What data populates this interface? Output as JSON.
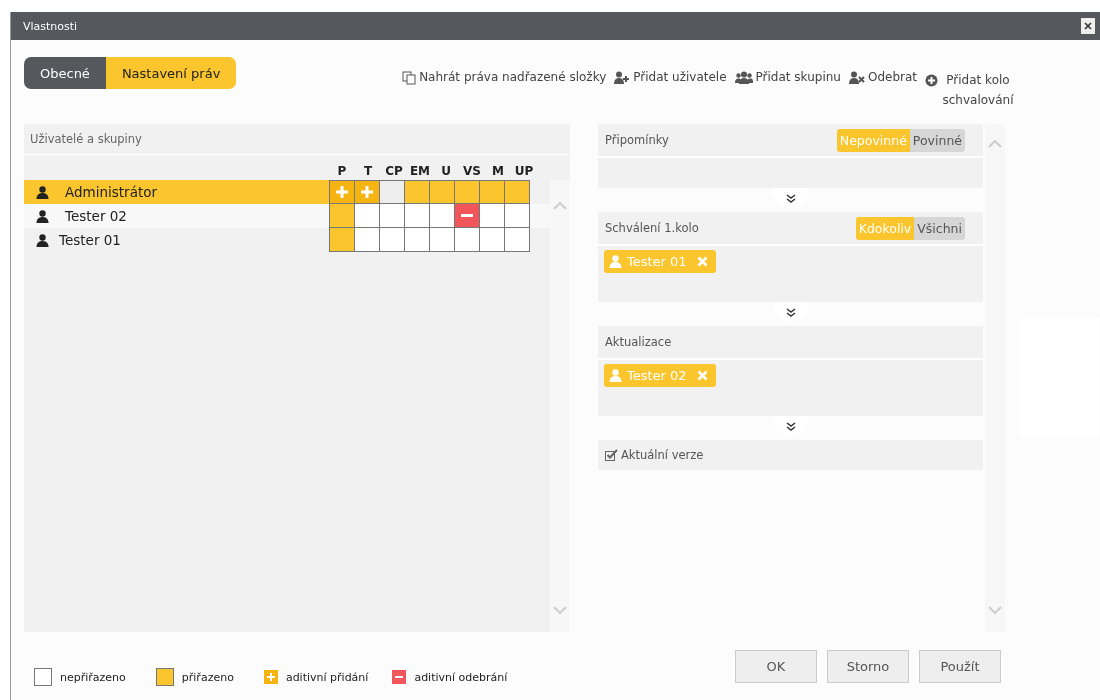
{
  "window": {
    "title": "Vlastnosti"
  },
  "tabs": [
    {
      "label": "Obecné",
      "selected": false
    },
    {
      "label": "Nastavení práv",
      "selected": true
    }
  ],
  "toolbar": [
    {
      "kind": "copy",
      "label": "Nahrát práva nadřazené složky"
    },
    {
      "kind": "add-user",
      "label": "Přidat uživatele"
    },
    {
      "kind": "add-group",
      "label": "Přidat skupinu"
    },
    {
      "kind": "remove-user",
      "label": "Odebrat"
    },
    {
      "kind": "add-round",
      "label": "Přidat kolo schvalování"
    }
  ],
  "permissions": {
    "title": "Uživatelé a skupiny",
    "columns": [
      "P",
      "T",
      "CP",
      "EM",
      "U",
      "VS",
      "M",
      "UP"
    ],
    "rows": [
      {
        "name": "Administrátor",
        "selected": true,
        "cells": [
          {
            "kind": "add"
          },
          {
            "kind": "add"
          },
          {
            "kind": "empty"
          },
          {
            "kind": "assigned"
          },
          {
            "kind": "assigned"
          },
          {
            "kind": "assigned"
          },
          {
            "kind": "assigned"
          },
          {
            "kind": "assigned"
          }
        ]
      },
      {
        "name": "Tester 02",
        "selected": false,
        "cells": [
          {
            "kind": "assigned"
          },
          {
            "kind": "empty"
          },
          {
            "kind": "empty"
          },
          {
            "kind": "empty"
          },
          {
            "kind": "empty"
          },
          {
            "kind": "remove"
          },
          {
            "kind": "empty"
          },
          {
            "kind": "empty"
          }
        ]
      },
      {
        "name": "Tester 01",
        "selected": false,
        "cells": [
          {
            "kind": "assigned"
          },
          {
            "kind": "empty"
          },
          {
            "kind": "empty"
          },
          {
            "kind": "empty"
          },
          {
            "kind": "empty"
          },
          {
            "kind": "empty"
          },
          {
            "kind": "empty"
          },
          {
            "kind": "empty"
          }
        ]
      }
    ]
  },
  "approval": [
    {
      "kind": "round",
      "title": "Připomínky",
      "options": [
        {
          "label": "Nepovinné",
          "selected": true
        },
        {
          "label": "Povinné",
          "selected": false
        }
      ]
    },
    {
      "kind": "round",
      "title": "Schválení 1.kolo",
      "options": [
        {
          "label": "Kdokoliv",
          "selected": true
        },
        {
          "label": "Všichni",
          "selected": false
        }
      ],
      "members": [
        "Tester 01"
      ]
    },
    {
      "kind": "round",
      "title": "Aktualizace",
      "members": [
        "Tester 02"
      ]
    },
    {
      "kind": "check",
      "title": "Aktuální verze",
      "checked": true
    }
  ],
  "legend": [
    {
      "kind": "empty",
      "label": "nepřiřazeno"
    },
    {
      "kind": "assigned",
      "label": "přiřazeno"
    },
    {
      "kind": "add",
      "label": "aditivní přidání"
    },
    {
      "kind": "remove",
      "label": "aditivní odebrání"
    }
  ],
  "buttons": [
    "OK",
    "Storno",
    "Použít"
  ]
}
